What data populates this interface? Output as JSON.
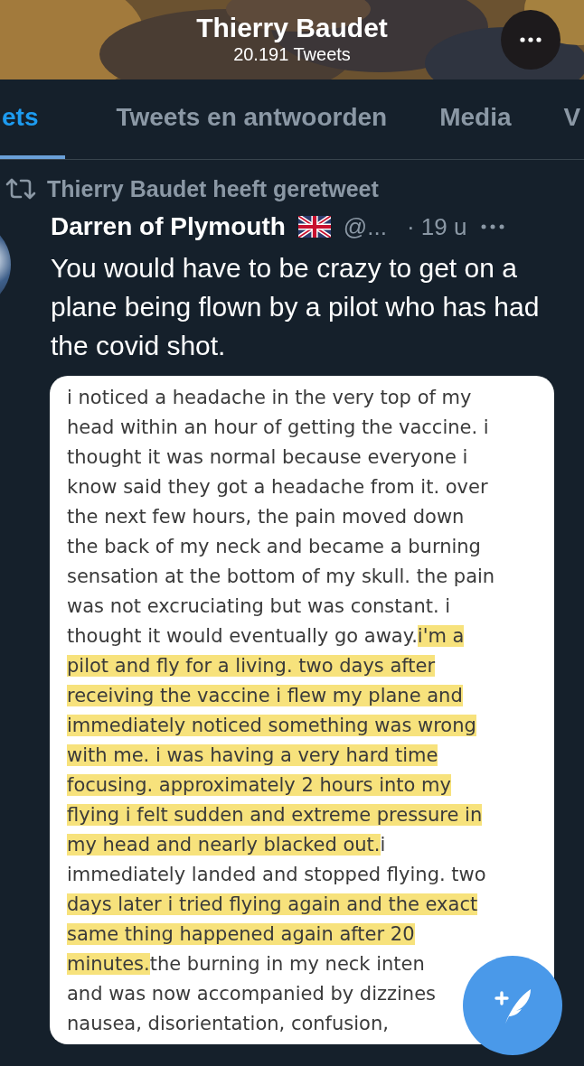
{
  "header": {
    "title": "Thierry Baudet",
    "subtitle": "20.191 Tweets"
  },
  "tabs": [
    {
      "label": "ets",
      "selected": true
    },
    {
      "label": "Tweets en antwoorden",
      "selected": false
    },
    {
      "label": "Media",
      "selected": false
    },
    {
      "label": "V",
      "selected": false
    }
  ],
  "tweet": {
    "retweet_note": "Thierry Baudet heeft geretweet",
    "author": "Darren of Plymouth",
    "handle": "@...",
    "time": "· 19 u",
    "text": "You would have to be crazy to get on a plane being flown by a pilot who has had the covid shot.",
    "attached_image": {
      "lines": [
        [
          {
            "text": "i noticed a headache in the very top of my",
            "highlighted": false
          }
        ],
        [
          {
            "text": "head within an hour of getting the vaccine. i",
            "highlighted": false
          }
        ],
        [
          {
            "text": "thought it was normal because everyone i",
            "highlighted": false
          }
        ],
        [
          {
            "text": "know said they got a headache from it. over",
            "highlighted": false
          }
        ],
        [
          {
            "text": "the next few hours, the pain moved down",
            "highlighted": false
          }
        ],
        [
          {
            "text": "the back of my neck and became a burning",
            "highlighted": false
          }
        ],
        [
          {
            "text": "sensation at the bottom of my skull. the pain",
            "highlighted": false
          }
        ],
        [
          {
            "text": "was not excruciating but was constant. i",
            "highlighted": false
          }
        ],
        [
          {
            "text": "thought it would eventually go away.",
            "highlighted": false
          },
          {
            "text": "i'm a",
            "highlighted": true
          }
        ],
        [
          {
            "text": "pilot and fly for a living. two days after",
            "highlighted": true
          }
        ],
        [
          {
            "text": "receiving the vaccine i flew my plane and",
            "highlighted": true
          }
        ],
        [
          {
            "text": "immediately noticed something was wrong",
            "highlighted": true
          }
        ],
        [
          {
            "text": "with me. i was having a very hard time",
            "highlighted": true
          }
        ],
        [
          {
            "text": "focusing. approximately 2 hours into my",
            "highlighted": true
          }
        ],
        [
          {
            "text": "flying i felt sudden and extreme pressure in",
            "highlighted": true
          }
        ],
        [
          {
            "text": "my head and nearly blacked out.",
            "highlighted": true
          },
          {
            "text": "i",
            "highlighted": false
          }
        ],
        [
          {
            "text": "immediately landed and stopped flying. two",
            "highlighted": false
          }
        ],
        [
          {
            "text": "days later i tried flying again and the exact",
            "highlighted": true
          }
        ],
        [
          {
            "text": "same thing happened again after 20",
            "highlighted": true
          }
        ],
        [
          {
            "text": "minutes.",
            "highlighted": true
          },
          {
            "text": "the burning in my neck inten",
            "highlighted": false
          }
        ],
        [
          {
            "text": "and was now accompanied by dizzines",
            "highlighted": false
          }
        ],
        [
          {
            "text": "nausea, disorientation, confusion,",
            "highlighted": false
          }
        ]
      ]
    }
  }
}
